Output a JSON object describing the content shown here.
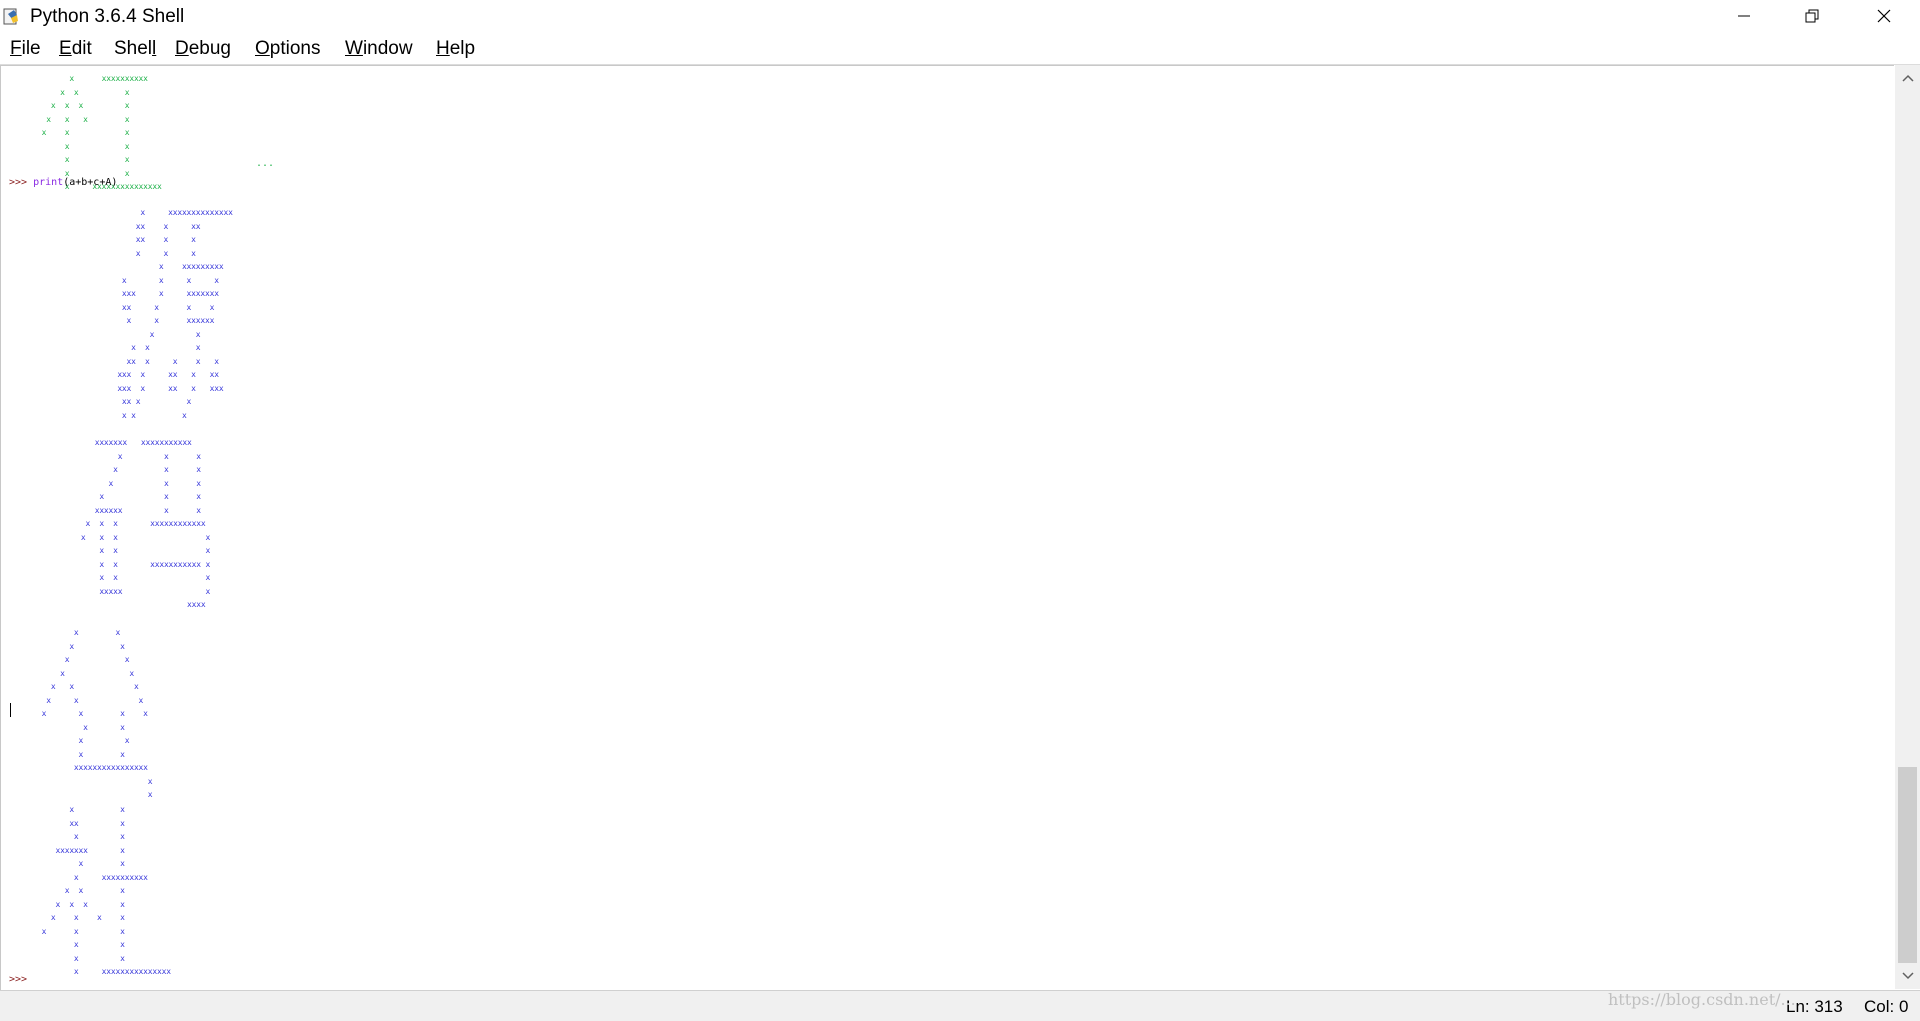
{
  "window": {
    "title": "Python 3.6.4 Shell",
    "icon": "python-idle-icon",
    "controls": {
      "minimize": "minimize-icon",
      "restore": "restore-icon",
      "close": "close-icon"
    }
  },
  "menu": {
    "file": {
      "mnemonic": "F",
      "rest": "ile"
    },
    "edit": {
      "mnemonic": "E",
      "rest": "dit"
    },
    "shell": {
      "pre": "Shel",
      "mnemonic": "l"
    },
    "debug": {
      "mnemonic": "D",
      "rest": "ebug"
    },
    "options": {
      "mnemonic": "O",
      "rest": "ptions"
    },
    "window": {
      "mnemonic": "W",
      "rest": "indow"
    },
    "help": {
      "mnemonic": "H",
      "rest": "elp"
    }
  },
  "shell": {
    "prompt": ">>>",
    "command_kw": "print",
    "command_args": "(a+b+c+A)",
    "continuation": "...",
    "output_colors": {
      "previous": "#22b24c",
      "current": "#3a3adb"
    },
    "previous_output": "       x      xxxxxxxxxx\n     x  x          x\n   x  x  x         x\n  x   x   x        x\n x    x            x\n      x            x\n      x            x\n      x            x\n      x     xxxxxxxxxxxxxxx",
    "blocks": [
      "            x     xxxxxxxxxxxxxx\n           xx    x     xx\n           xx    x     x\n           x     x     x\n                x    xxxxxxxxx\n        x       x     x     x\n        xxx     x     xxxxxxx\n        xx     x      x    x\n         x     x      xxxxxx\n              x         x\n          x  x          x\n         xx  x     x    x   x\n       xxx  x     xx   x   xx\n       xxx  x     xx   x   xxx\n        xx x          x\n        x x          x",
      "      xxxxxxx   xxxxxxxxxxx\n           x         x      x\n          x          x      x\n         x           x      x\n       x             x      x\n      xxxxxx         x      x\n    x  x  x       xxxxxxxxxxxx\n   x   x  x                   x\n       x  x                   x\n       x  x       xxxxxxxxxxx x\n       x  x                   x\n       xxxxx                  x\n                          xxxx",
      "        x        x\n       x          x\n      x            x\n     x              x\n   x   x             x\n  x     x             x\n x       x        x    x\n          x       x\n         x         x\n         x        x\n        xxxxxxxxxxxxxxxx\n                        x\n                        x",
      "       x          x\n       xx         x\n        x         x\n    xxxxxxx       x\n         x        x\n        x     xxxxxxxxxx\n      x  x        x\n    x  x  x       x\n   x    x    x    x\n x      x         x\n        x         x\n        x         x\n        x     xxxxxxxxxxxxxxx"
    ]
  },
  "scrollbar": {
    "up": "scroll-up-arrow-icon",
    "down": "scroll-down-arrow-icon"
  },
  "status": {
    "line": "Ln: 313",
    "col": "Col: 0"
  },
  "watermark": "https://blog.csdn.net/..."
}
